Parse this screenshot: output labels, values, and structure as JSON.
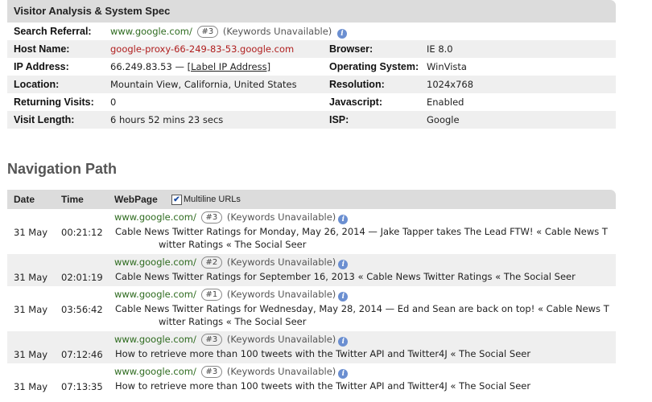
{
  "spec": {
    "title": "Visitor Analysis & System Spec",
    "search_referral_label": "Search Referral:",
    "search_referral_site": "www.google.com/",
    "search_referral_badge": "#3",
    "search_referral_keywords": "(Keywords Unavailable)",
    "host_name_label": "Host Name:",
    "host_name": "google-proxy-66-249-83-53.google.com",
    "browser_label": "Browser:",
    "browser": "IE 8.0",
    "ip_label": "IP Address:",
    "ip": "66.249.83.53 —",
    "ip_link": "[Label IP Address]",
    "os_label": "Operating System:",
    "os": "WinVista",
    "location_label": "Location:",
    "location": "Mountain View, California, United States",
    "resolution_label": "Resolution:",
    "resolution": "1024x768",
    "returning_label": "Returning Visits:",
    "returning": "0",
    "javascript_label": "Javascript:",
    "javascript": "Enabled",
    "visit_length_label": "Visit Length:",
    "visit_length": "6 hours 52 mins 23 secs",
    "isp_label": "ISP:",
    "isp": "Google"
  },
  "nav": {
    "title": "Navigation Path",
    "col_date": "Date",
    "col_time": "Time",
    "col_webpage": "WebPage",
    "multiline_label": "Multiline URLs",
    "multiline_checked": true,
    "rows": [
      {
        "site": "www.google.com/",
        "badge": "#3",
        "keywords": "(Keywords Unavailable)",
        "date": "31 May",
        "time": "00:21:12",
        "page1": "Cable News Twitter Ratings for Monday, May 26, 2014 — Jake Tapper takes The Lead FTW! « Cable News T",
        "page2": "witter Ratings « The Social Seer"
      },
      {
        "site": "www.google.com/",
        "badge": "#2",
        "keywords": "(Keywords Unavailable)",
        "date": "31 May",
        "time": "02:01:19",
        "page1": "Cable News Twitter Ratings for September 16, 2013 « Cable News Twitter Ratings « The Social Seer",
        "page2": ""
      },
      {
        "site": "www.google.com/",
        "badge": "#1",
        "keywords": "(Keywords Unavailable)",
        "date": "31 May",
        "time": "03:56:42",
        "page1": "Cable News Twitter Ratings for Wednesday, May 28, 2014 — Ed and Sean are back on top! « Cable News T",
        "page2": "witter Ratings « The Social Seer"
      },
      {
        "site": "www.google.com/",
        "badge": "#3",
        "keywords": "(Keywords Unavailable)",
        "date": "31 May",
        "time": "07:12:46",
        "page1": "How to retrieve more than 100 tweets with the Twitter API and Twitter4J « The Social Seer",
        "page2": ""
      },
      {
        "site": "www.google.com/",
        "badge": "#3",
        "keywords": "(Keywords Unavailable)",
        "date": "31 May",
        "time": "07:13:35",
        "page1": "How to retrieve more than 100 tweets with the Twitter API and Twitter4J « The Social Seer",
        "page2": ""
      }
    ]
  },
  "icons": {
    "info": "info-icon",
    "checkbox": "checkbox-icon"
  }
}
